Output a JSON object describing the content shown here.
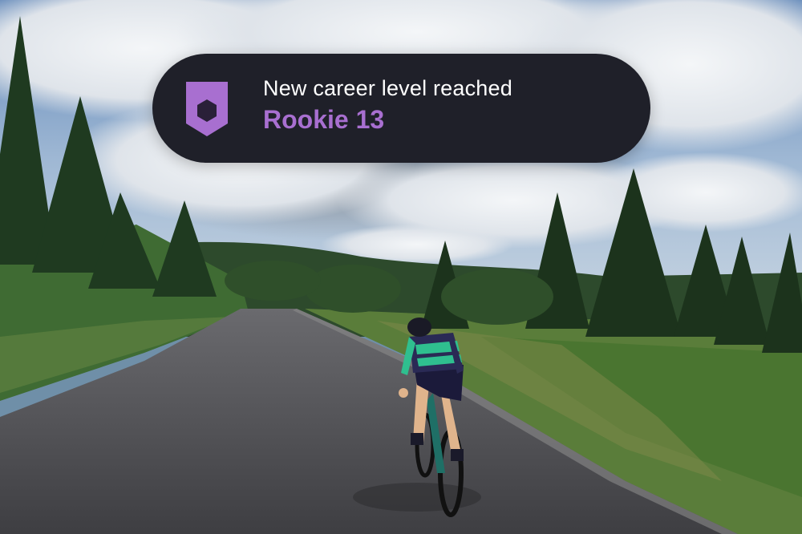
{
  "notification": {
    "title": "New career level reached",
    "level": "Rookie 13",
    "badge_icon": "career-level-badge-icon",
    "accent_color": "#a86fd0",
    "background_color": "#1f2029"
  }
}
